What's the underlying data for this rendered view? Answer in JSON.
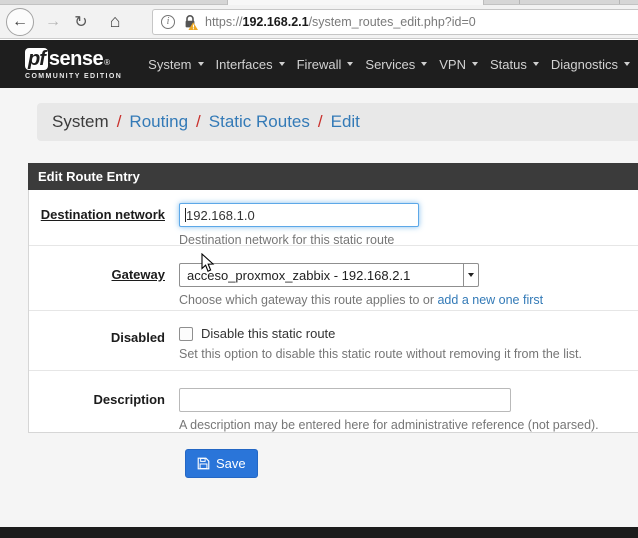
{
  "browser": {
    "back_icon": "←",
    "forward_icon": "→",
    "refresh_icon": "↻",
    "home_icon": "⌂",
    "url": {
      "scheme": "https://",
      "host": "192.168.2.1",
      "path": "/system_routes_edit.php?id=0"
    }
  },
  "navbar": {
    "logo": {
      "pf": "pf",
      "sense": "sense",
      "reg": "®",
      "edition": "COMMUNITY EDITION"
    },
    "items": [
      {
        "label": "System"
      },
      {
        "label": "Interfaces"
      },
      {
        "label": "Firewall"
      },
      {
        "label": "Services"
      },
      {
        "label": "VPN"
      },
      {
        "label": "Status"
      },
      {
        "label": "Diagnostics"
      }
    ]
  },
  "breadcrumb": {
    "separator": "/",
    "items": [
      {
        "label": "System"
      },
      {
        "label": "Routing"
      },
      {
        "label": "Static Routes"
      },
      {
        "label": "Edit"
      }
    ]
  },
  "panel": {
    "title": "Edit Route Entry",
    "fields": [
      {
        "label": "Destination network",
        "value": "192.168.1.0",
        "help": "Destination network for this static route"
      },
      {
        "label": "Gateway",
        "value": "acceso_proxmox_zabbix - 192.168.2.1",
        "help_prefix": "Choose which gateway this route applies to or ",
        "help_link": "add a new one first"
      },
      {
        "label": "Disabled",
        "checkbox_label": "Disable this static route",
        "checked": false,
        "help": "Set this option to disable this static route without removing it from the list."
      },
      {
        "label": "Description",
        "value": "",
        "help": "A description may be entered here for administrative reference (not parsed)."
      }
    ]
  },
  "actions": {
    "save": "Save"
  },
  "colors": {
    "link_blue": "#337ab7",
    "breadcrumb_red": "#c9302c",
    "save_blue": "#2a75d9",
    "navbar_bg": "#1e1e1e",
    "panel_header_bg": "#3b3b3b",
    "warning_orange": "#eda723",
    "page_bg": "#f5f5f5"
  }
}
